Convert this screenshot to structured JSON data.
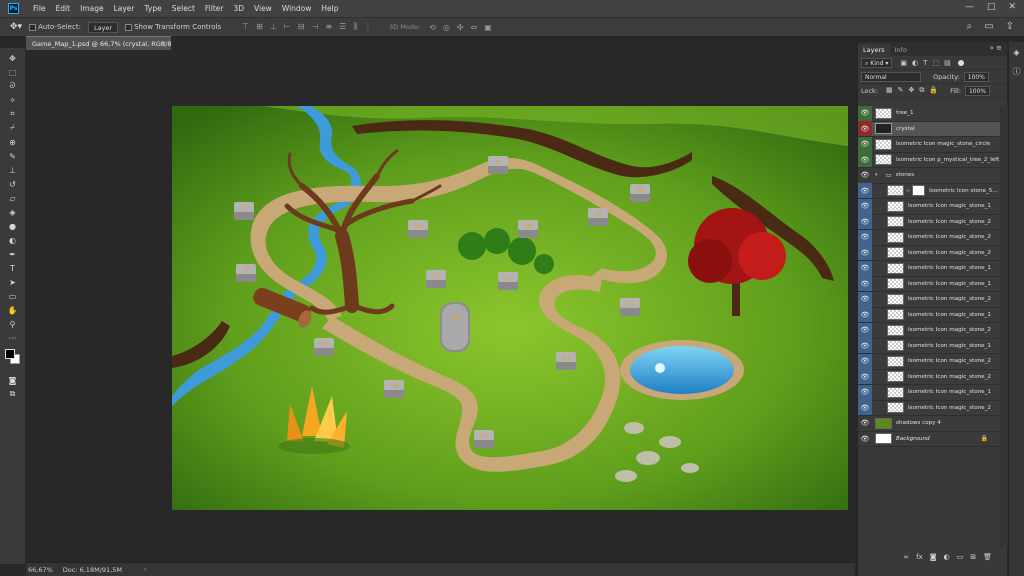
{
  "app": {
    "logo": "Ps"
  },
  "menu": [
    "File",
    "Edit",
    "Image",
    "Layer",
    "Type",
    "Select",
    "Filter",
    "3D",
    "View",
    "Window",
    "Help"
  ],
  "window_controls": [
    "—",
    "□",
    "✕"
  ],
  "options": {
    "auto_select": "Auto-Select:",
    "auto_select_value": "Layer",
    "show_transform": "Show Transform Controls",
    "mode_3d": "3D Mode:"
  },
  "document": {
    "tab_title": "Game_Map_1.psd @ 66,7% (crystal, RGB/8#) *",
    "tab_close": "×"
  },
  "status": {
    "zoom": "66,67%",
    "doc_size": "Doc: 6,18M/91,5M"
  },
  "layers_panel": {
    "tabs": [
      "Layers",
      "Info"
    ],
    "kind": "Kind",
    "blend_mode": "Normal",
    "opacity_label": "Opacity:",
    "opacity_value": "100%",
    "lock_label": "Lock:",
    "fill_label": "Fill:",
    "fill_value": "100%",
    "layers": [
      {
        "name": "tree_1",
        "eye": "green",
        "thumb": "checker"
      },
      {
        "name": "crystal",
        "eye": "red",
        "thumb": "checker",
        "selected": true
      },
      {
        "name": "Isometric Icon magic_stone_circle",
        "eye": "green",
        "thumb": "checker"
      },
      {
        "name": "Isometric Icon p_mystical_tree_2_left",
        "eye": "green",
        "thumb": "checker"
      },
      {
        "name": "stones",
        "eye": "plain",
        "thumb": "folder"
      },
      {
        "name": "Isometric Icon stone_5...",
        "eye": "blue",
        "thumb": "checker",
        "mask": true
      },
      {
        "name": "Isometric Icon magic_stone_1",
        "eye": "blue",
        "thumb": "checker"
      },
      {
        "name": "Isometric Icon magic_stone_2",
        "eye": "blue",
        "thumb": "checker"
      },
      {
        "name": "Isometric Icon magic_stone_2",
        "eye": "blue",
        "thumb": "checker"
      },
      {
        "name": "Isometric Icon magic_stone_2",
        "eye": "blue",
        "thumb": "checker"
      },
      {
        "name": "Isometric Icon magic_stone_1",
        "eye": "blue",
        "thumb": "checker"
      },
      {
        "name": "Isometric Icon magic_stone_1",
        "eye": "blue",
        "thumb": "checker"
      },
      {
        "name": "Isometric Icon magic_stone_2",
        "eye": "blue",
        "thumb": "checker"
      },
      {
        "name": "Isometric Icon magic_stone_1",
        "eye": "blue",
        "thumb": "checker"
      },
      {
        "name": "Isometric Icon magic_stone_2",
        "eye": "blue",
        "thumb": "checker"
      },
      {
        "name": "Isometric Icon magic_stone_1",
        "eye": "blue",
        "thumb": "checker"
      },
      {
        "name": "Isometric Icon magic_stone_2",
        "eye": "blue",
        "thumb": "checker"
      },
      {
        "name": "Isometric Icon magic_stone_2",
        "eye": "blue",
        "thumb": "checker"
      },
      {
        "name": "Isometric Icon magic_stone_1",
        "eye": "blue",
        "thumb": "checker"
      },
      {
        "name": "Isometric Icon magic_stone_2",
        "eye": "blue",
        "thumb": "checker"
      },
      {
        "name": "shadows copy 4",
        "eye": "plain",
        "thumb": "green"
      },
      {
        "name": "Background",
        "eye": "plain",
        "thumb": "white",
        "locked": true,
        "italic": true
      }
    ]
  },
  "map_stones": [
    "37",
    "5",
    "10",
    "9",
    "25",
    "36",
    "29",
    "81",
    "65",
    "61",
    "78",
    "70",
    "73",
    "11",
    "56",
    "50"
  ],
  "colors": {
    "eye_green": "#3c6d3a",
    "eye_red": "#8e2b2b",
    "eye_blue": "#41638f",
    "panel_bg": "#393939",
    "workspace_bg": "#282828"
  }
}
